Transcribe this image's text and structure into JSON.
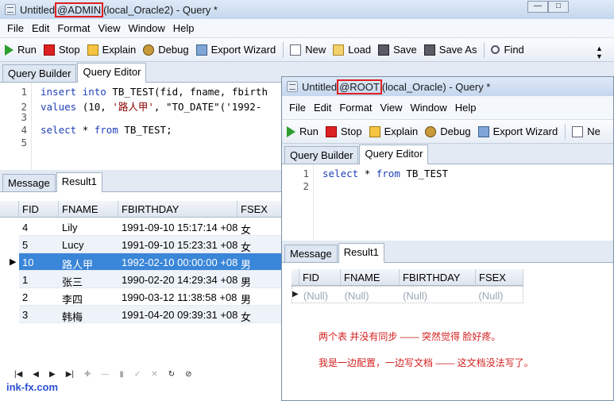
{
  "win1": {
    "title_prefix": "Untitled ",
    "title_highlight": "@ADMIN",
    "title_suffix": " (local_Oracle2) - Query *",
    "menu": [
      "File",
      "Edit",
      "Format",
      "View",
      "Window",
      "Help"
    ],
    "toolbar": {
      "run": "Run",
      "stop": "Stop",
      "explain": "Explain",
      "debug": "Debug",
      "export": "Export Wizard",
      "new": "New",
      "load": "Load",
      "save": "Save",
      "save_as": "Save As",
      "find": "Find"
    },
    "tabs": [
      "Query Builder",
      "Query Editor"
    ],
    "code": [
      {
        "n": "1",
        "kw": "insert into ",
        "txt": "TB_TEST(fid, fname, fbirth"
      },
      {
        "n": "2",
        "kw": "values ",
        "txt": "(10, ",
        "str": "'路人甲'",
        "txt2": ", \"TO_DATE\"('1992-"
      },
      {
        "n": "3",
        "kw": "",
        "txt": ""
      },
      {
        "n": "4",
        "kw": "select ",
        "txt": "* ",
        "kw2": "from ",
        "txt2": "TB_TEST;"
      },
      {
        "n": "5",
        "kw": "",
        "txt": ""
      }
    ],
    "result_tabs": [
      "Message",
      "Result1"
    ],
    "columns": [
      "FID",
      "FNAME",
      "FBIRTHDAY",
      "FSEX"
    ],
    "rows": [
      [
        "4",
        "Lily",
        "1991-09-10 15:17:14 +08",
        "女"
      ],
      [
        "5",
        "Lucy",
        "1991-09-10 15:23:31 +08",
        "女"
      ],
      [
        "10",
        "路人甲",
        "1992-02-10 00:00:00 +08",
        "男"
      ],
      [
        "1",
        "张三",
        "1990-02-20 14:29:34 +08",
        "男"
      ],
      [
        "2",
        "李四",
        "1990-03-12 11:38:58 +08",
        "男"
      ],
      [
        "3",
        "韩梅",
        "1991-04-20 09:39:31 +08",
        "女"
      ]
    ],
    "selected_row": 2
  },
  "win2": {
    "title_prefix": "Untitled ",
    "title_highlight": "@ROOT",
    "title_suffix": " (local_Oracle) - Query *",
    "menu": [
      "File",
      "Edit",
      "Format",
      "View",
      "Window",
      "Help"
    ],
    "toolbar": {
      "run": "Run",
      "stop": "Stop",
      "explain": "Explain",
      "debug": "Debug",
      "export": "Export Wizard",
      "new": "Ne"
    },
    "tabs": [
      "Query Builder",
      "Query Editor"
    ],
    "code": [
      {
        "n": "1",
        "kw": "select ",
        "txt": "* ",
        "kw2": "from ",
        "txt2": "TB_TEST"
      },
      {
        "n": "2",
        "kw": "",
        "txt": ""
      }
    ],
    "result_tabs": [
      "Message",
      "Result1"
    ],
    "columns": [
      "FID",
      "FNAME",
      "FBIRTHDAY",
      "FSEX"
    ],
    "null_row": [
      "(Null)",
      "(Null)",
      "(Null)",
      "(Null)"
    ],
    "note1": "两个表 并没有同步 —— 突然觉得 脸好疼。",
    "note2": "我是一边配置，一边写文档 —— 这文档没法写了。"
  },
  "watermark": "ink-fx.com",
  "colors": {
    "highlight_box": "#e02020",
    "selected_row": "#3a86d8",
    "note_text": "#d42020",
    "keyword": "#1f3fb8",
    "string": "#8b0000"
  }
}
